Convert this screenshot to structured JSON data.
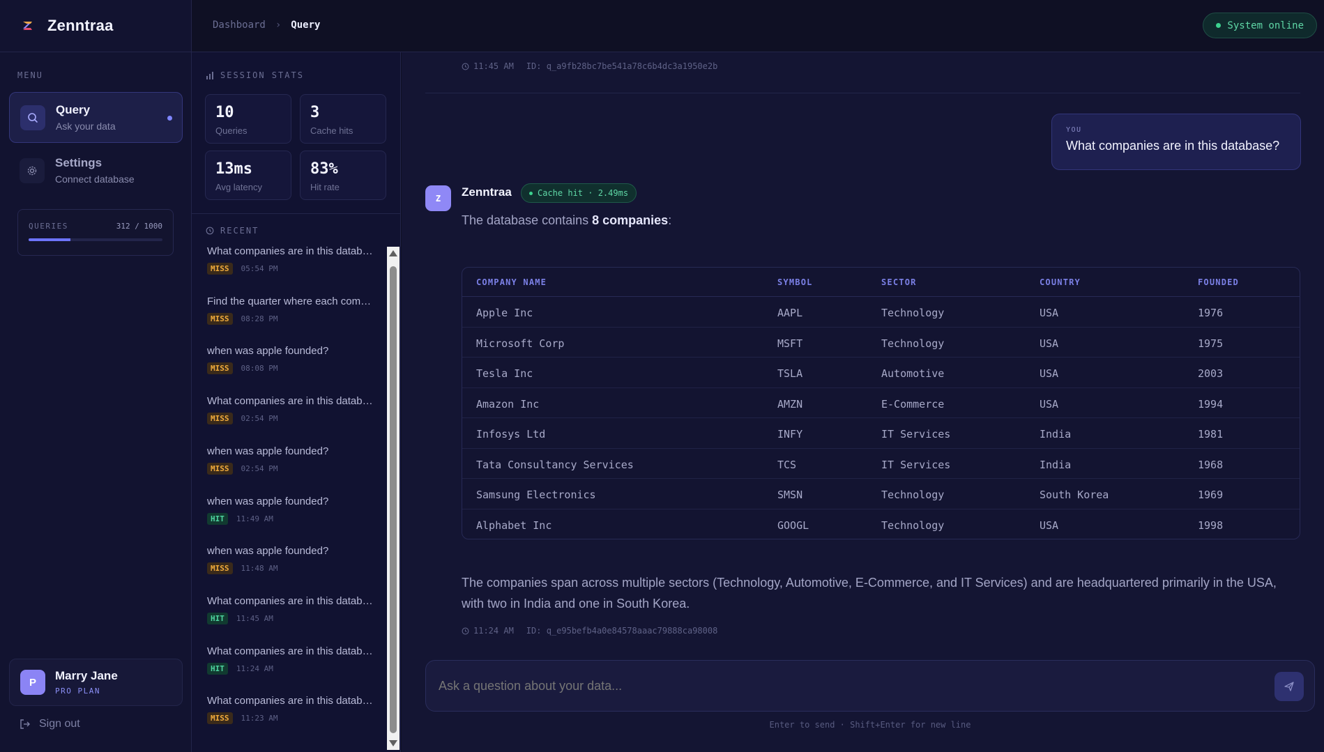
{
  "brand": {
    "name": "Zenntraa"
  },
  "sidebar": {
    "menu_label": "MENU",
    "items": [
      {
        "title": "Query",
        "subtitle": "Ask your data",
        "icon": "search-icon"
      },
      {
        "title": "Settings",
        "subtitle": "Connect database",
        "icon": "gear-icon"
      }
    ],
    "quota": {
      "label": "QUERIES",
      "count": "312 / 1000",
      "fraction": 0.312
    },
    "user": {
      "initial": "P",
      "name": "Marry Jane",
      "plan": "PRO PLAN"
    },
    "signout": "Sign out"
  },
  "topbar": {
    "breadcrumb": [
      "Dashboard",
      "Query"
    ],
    "status": "System online"
  },
  "stats": {
    "heading": "SESSION STATS",
    "cards": [
      {
        "value": "10",
        "label": "Queries"
      },
      {
        "value": "3",
        "label": "Cache hits"
      },
      {
        "value": "13ms",
        "label": "Avg latency"
      },
      {
        "value": "83%",
        "label": "Hit rate"
      }
    ],
    "recent_heading": "RECENT",
    "recent": [
      {
        "text": "What companies are in this database?",
        "status": "MISS",
        "time": "05:54 PM"
      },
      {
        "text": "Find the quarter where each company had its highest revenue",
        "status": "MISS",
        "time": "08:28 PM"
      },
      {
        "text": "when was apple founded?",
        "status": "MISS",
        "time": "08:08 PM"
      },
      {
        "text": "What companies are in this database?",
        "status": "MISS",
        "time": "02:54 PM"
      },
      {
        "text": "when was apple founded?",
        "status": "MISS",
        "time": "02:54 PM"
      },
      {
        "text": "when was apple founded?",
        "status": "HIT",
        "time": "11:49 AM"
      },
      {
        "text": "when was apple founded?",
        "status": "MISS",
        "time": "11:48 AM"
      },
      {
        "text": "What companies are in this database?",
        "status": "HIT",
        "time": "11:45 AM"
      },
      {
        "text": "What companies are in this database?",
        "status": "HIT",
        "time": "11:24 AM"
      },
      {
        "text": "What companies are in this database?",
        "status": "MISS",
        "time": "11:23 AM"
      }
    ]
  },
  "chat": {
    "prev_meta": {
      "time": "11:45 AM",
      "id": "ID: q_a9fb28bc7be541a78c6b4dc3a1950e2b"
    },
    "user_label": "YOU",
    "user_message": "What companies are in this database?",
    "bot_initial": "Z",
    "bot_name": "Zenntraa",
    "cache_badge": "Cache hit · 2.49ms",
    "intro_prefix": "The database contains ",
    "intro_bold": "8 companies",
    "intro_suffix": ":",
    "table": {
      "headers": [
        "COMPANY NAME",
        "SYMBOL",
        "SECTOR",
        "COUNTRY",
        "FOUNDED"
      ],
      "rows": [
        [
          "Apple Inc",
          "AAPL",
          "Technology",
          "USA",
          "1976"
        ],
        [
          "Microsoft Corp",
          "MSFT",
          "Technology",
          "USA",
          "1975"
        ],
        [
          "Tesla Inc",
          "TSLA",
          "Automotive",
          "USA",
          "2003"
        ],
        [
          "Amazon Inc",
          "AMZN",
          "E-Commerce",
          "USA",
          "1994"
        ],
        [
          "Infosys Ltd",
          "INFY",
          "IT Services",
          "India",
          "1981"
        ],
        [
          "Tata Consultancy Services",
          "TCS",
          "IT Services",
          "India",
          "1968"
        ],
        [
          "Samsung Electronics",
          "SMSN",
          "Technology",
          "South Korea",
          "1969"
        ],
        [
          "Alphabet Inc",
          "GOOGL",
          "Technology",
          "USA",
          "1998"
        ]
      ]
    },
    "summary": "The companies span across multiple sectors (Technology, Automotive, E-Commerce, and IT Services) and are headquartered primarily in the USA, with two in India and one in South Korea.",
    "bot_meta": {
      "time": "11:24 AM",
      "id": "ID: q_e95befb4a0e84578aaac79888ca98008"
    }
  },
  "composer": {
    "placeholder": "Ask a question about your data...",
    "hint": "Enter to send · Shift+Enter for new line"
  },
  "colors": {
    "accent": "#7f86ff",
    "hit": "#4fd4a0",
    "miss": "#f1ab3b",
    "online": "#3cd28e"
  }
}
